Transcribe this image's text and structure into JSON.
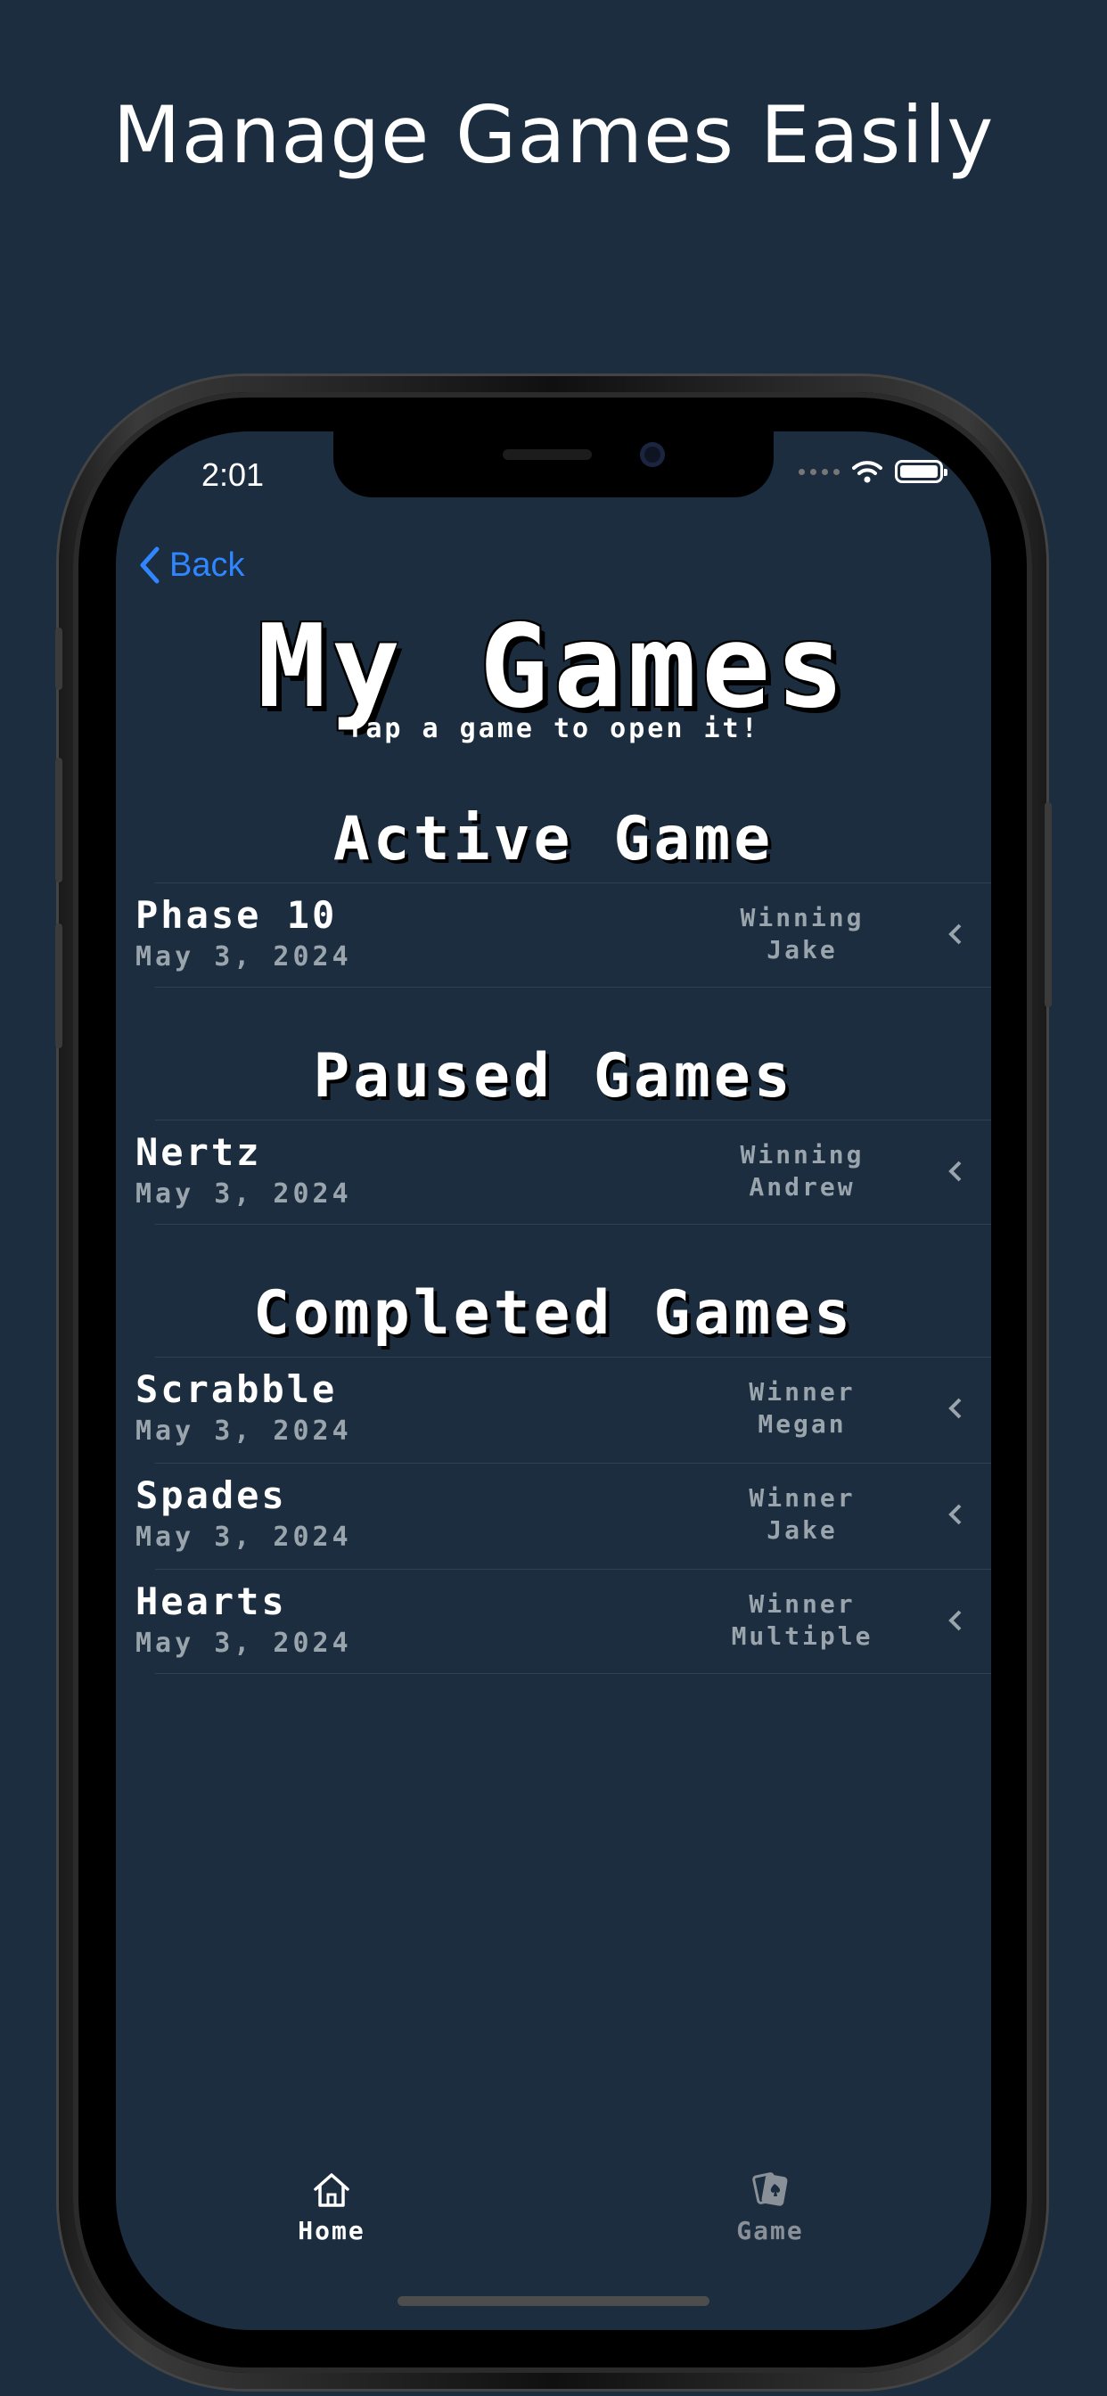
{
  "headline": "Manage Games Easily",
  "status_bar": {
    "time": "2:01"
  },
  "nav": {
    "back_label": "Back"
  },
  "page": {
    "title": "My Games",
    "subtitle": "Tap a game to open it!"
  },
  "sections": {
    "active": {
      "title": "Active Game",
      "rows": [
        {
          "name": "Phase 10",
          "date": "May 3, 2024",
          "status": "Winning",
          "player": "Jake"
        }
      ]
    },
    "paused": {
      "title": "Paused Games",
      "rows": [
        {
          "name": "Nertz",
          "date": "May 3, 2024",
          "status": "Winning",
          "player": "Andrew"
        }
      ]
    },
    "completed": {
      "title": "Completed Games",
      "rows": [
        {
          "name": "Scrabble",
          "date": "May 3, 2024",
          "status": "Winner",
          "player": "Megan"
        },
        {
          "name": "Spades",
          "date": "May 3, 2024",
          "status": "Winner",
          "player": "Jake"
        },
        {
          "name": "Hearts",
          "date": "May 3, 2024",
          "status": "Winner",
          "player": "Multiple"
        }
      ]
    }
  },
  "tabbar": {
    "tabs": [
      {
        "label": "Home",
        "icon": "house-icon",
        "selected": true
      },
      {
        "label": "Game",
        "icon": "cards-icon",
        "selected": false
      }
    ]
  },
  "colors": {
    "background": "#1b2d3e",
    "accent": "#2f86ff",
    "text": "#ffffff",
    "muted": "#9aa4ad"
  }
}
